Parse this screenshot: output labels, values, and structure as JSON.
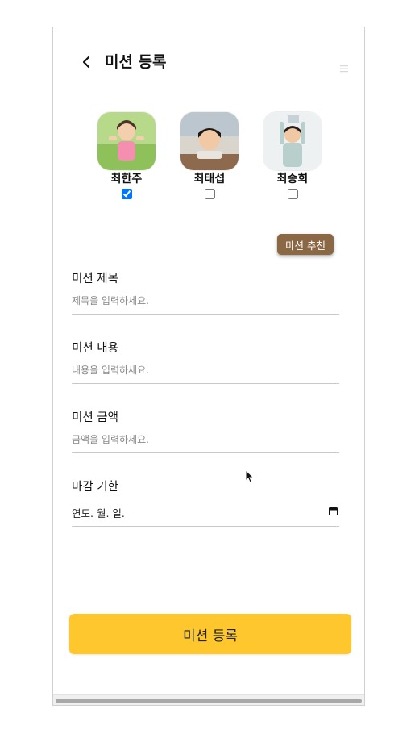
{
  "header": {
    "title": "미션 등록",
    "back_icon": "chevron-left-icon",
    "corner_icon": "menu-icon"
  },
  "children": [
    {
      "name": "최한주",
      "checked": true
    },
    {
      "name": "최태섭",
      "checked": false
    },
    {
      "name": "최송희",
      "checked": false
    }
  ],
  "recommend_button": "미션 추천",
  "fields": {
    "title": {
      "label": "미션 제목",
      "placeholder": "제목을 입력하세요."
    },
    "content": {
      "label": "미션 내용",
      "placeholder": "내용을 입력하세요."
    },
    "amount": {
      "label": "미션 금액",
      "placeholder": "금액을 입력하세요."
    },
    "deadline": {
      "label": "마감 기한",
      "value": "연도. 월. 일."
    }
  },
  "submit_button": "미션 등록",
  "colors": {
    "accent": "#fec72e",
    "recommend": "#8a6845"
  }
}
